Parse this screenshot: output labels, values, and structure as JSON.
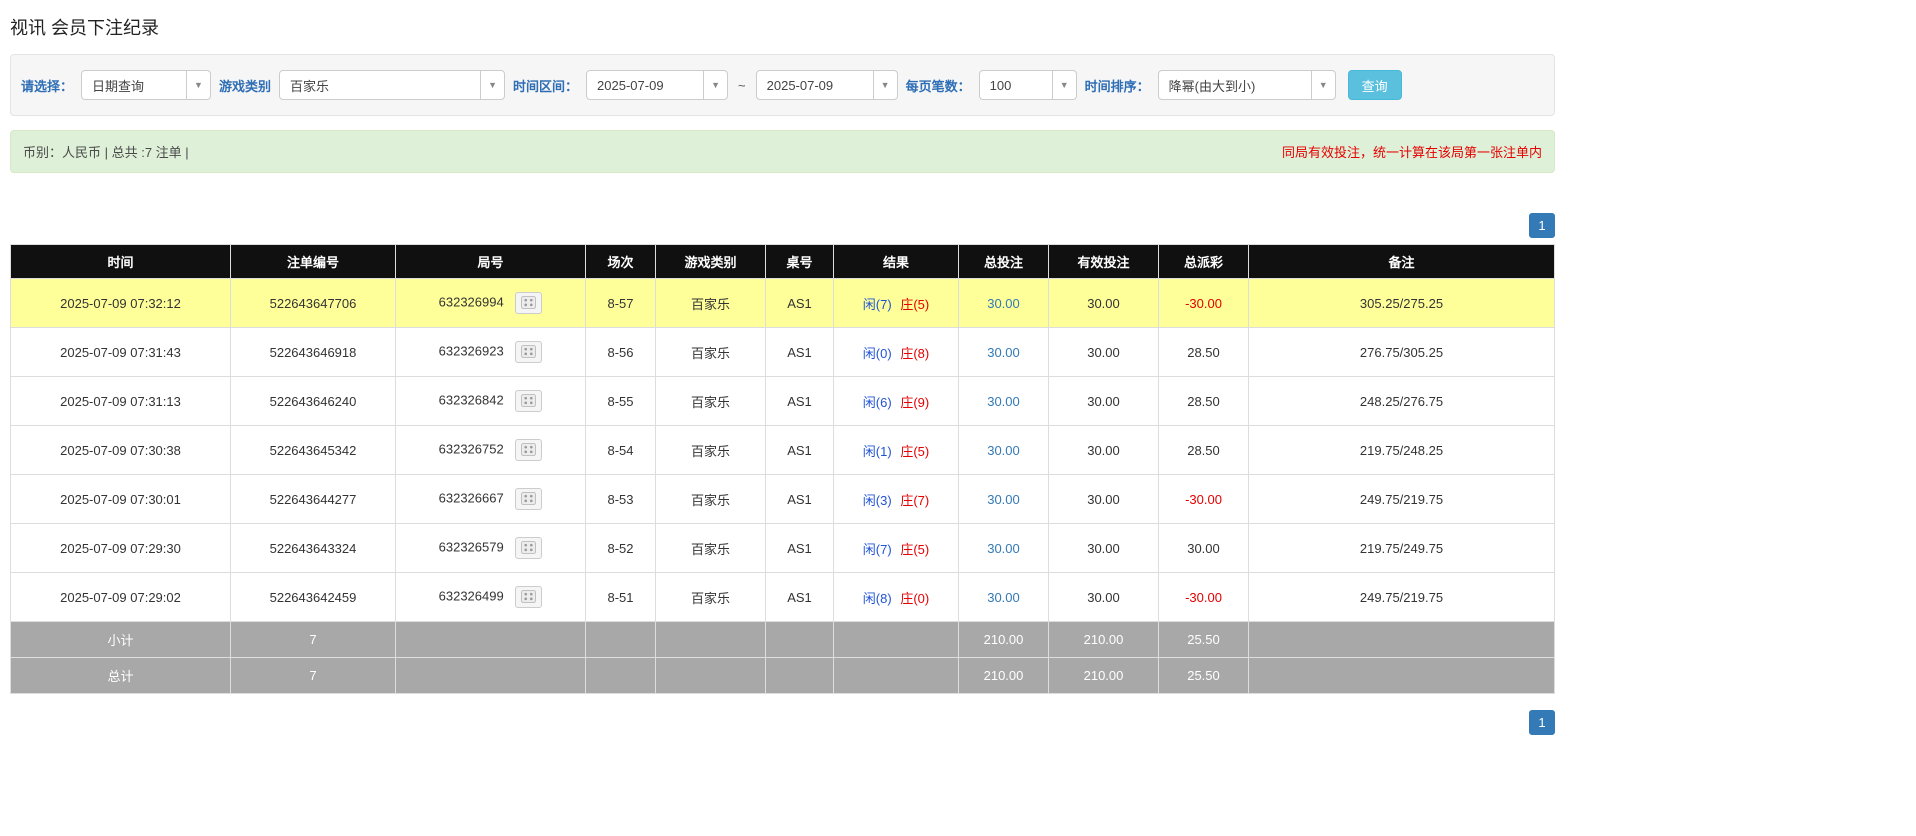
{
  "page": {
    "title": "视讯 会员下注纪录"
  },
  "filters": {
    "select_label": "请选择：",
    "select_value": "日期查询",
    "game_type_label": "游戏类别",
    "game_type_value": "百家乐",
    "time_range_label": "时间区间：",
    "time_from": "2025-07-09",
    "time_separator": "~",
    "time_to": "2025-07-09",
    "per_page_label": "每页笔数：",
    "per_page_value": "100",
    "sort_label": "时间排序：",
    "sort_value": "降幂(由大到小)",
    "search_button": "查询"
  },
  "summary": {
    "left": "币别：人民币 | 总共 :7 注单 |",
    "right": "同局有效投注，统一计算在该局第一张注单内"
  },
  "pagination": {
    "page": "1"
  },
  "table": {
    "headers": [
      "时间",
      "注单编号",
      "局号",
      "场次",
      "游戏类别",
      "桌号",
      "结果",
      "总投注",
      "有效投注",
      "总派彩",
      "备注"
    ],
    "rows": [
      {
        "highlight": true,
        "time": "2025-07-09 07:32:12",
        "bet_no": "522643647706",
        "round_no": "632326994",
        "session": "8-57",
        "game": "百家乐",
        "table": "AS1",
        "result": {
          "xian": "闲(7)",
          "zhuang": "庄(5)"
        },
        "total_bet": "30.00",
        "valid_bet": "30.00",
        "payout": "-30.00",
        "note": "305.25/275.25"
      },
      {
        "highlight": false,
        "time": "2025-07-09 07:31:43",
        "bet_no": "522643646918",
        "round_no": "632326923",
        "session": "8-56",
        "game": "百家乐",
        "table": "AS1",
        "result": {
          "xian": "闲(0)",
          "zhuang": "庄(8)"
        },
        "total_bet": "30.00",
        "valid_bet": "30.00",
        "payout": "28.50",
        "note": "276.75/305.25"
      },
      {
        "highlight": false,
        "time": "2025-07-09 07:31:13",
        "bet_no": "522643646240",
        "round_no": "632326842",
        "session": "8-55",
        "game": "百家乐",
        "table": "AS1",
        "result": {
          "xian": "闲(6)",
          "zhuang": "庄(9)"
        },
        "total_bet": "30.00",
        "valid_bet": "30.00",
        "payout": "28.50",
        "note": "248.25/276.75"
      },
      {
        "highlight": false,
        "time": "2025-07-09 07:30:38",
        "bet_no": "522643645342",
        "round_no": "632326752",
        "session": "8-54",
        "game": "百家乐",
        "table": "AS1",
        "result": {
          "xian": "闲(1)",
          "zhuang": "庄(5)"
        },
        "total_bet": "30.00",
        "valid_bet": "30.00",
        "payout": "28.50",
        "note": "219.75/248.25"
      },
      {
        "highlight": false,
        "time": "2025-07-09 07:30:01",
        "bet_no": "522643644277",
        "round_no": "632326667",
        "session": "8-53",
        "game": "百家乐",
        "table": "AS1",
        "result": {
          "xian": "闲(3)",
          "zhuang": "庄(7)"
        },
        "total_bet": "30.00",
        "valid_bet": "30.00",
        "payout": "-30.00",
        "note": "249.75/219.75"
      },
      {
        "highlight": false,
        "time": "2025-07-09 07:29:30",
        "bet_no": "522643643324",
        "round_no": "632326579",
        "session": "8-52",
        "game": "百家乐",
        "table": "AS1",
        "result": {
          "xian": "闲(7)",
          "zhuang": "庄(5)"
        },
        "total_bet": "30.00",
        "valid_bet": "30.00",
        "payout": "30.00",
        "note": "219.75/249.75"
      },
      {
        "highlight": false,
        "time": "2025-07-09 07:29:02",
        "bet_no": "522643642459",
        "round_no": "632326499",
        "session": "8-51",
        "game": "百家乐",
        "table": "AS1",
        "result": {
          "xian": "闲(8)",
          "zhuang": "庄(0)"
        },
        "total_bet": "30.00",
        "valid_bet": "30.00",
        "payout": "-30.00",
        "note": "249.75/219.75"
      }
    ],
    "subtotal": {
      "label": "小计",
      "count": "7",
      "total_bet": "210.00",
      "valid_bet": "210.00",
      "payout": "25.50"
    },
    "total": {
      "label": "总计",
      "count": "7",
      "total_bet": "210.00",
      "valid_bet": "210.00",
      "payout": "25.50"
    }
  },
  "colors": {
    "accent_blue": "#337ab7",
    "link_blue": "#337ab7",
    "label_blue": "#2e6eb5",
    "info_button": "#5bc0de",
    "info_button_border": "#46b8da",
    "highlight_yellow": "#ffff99",
    "header_black": "#101010",
    "footer_gray": "#a8a8a8",
    "red": "#e60000",
    "result_blue": "#2053d4",
    "summary_bg": "#dff0d8",
    "summary_border": "#d6e9c6"
  }
}
